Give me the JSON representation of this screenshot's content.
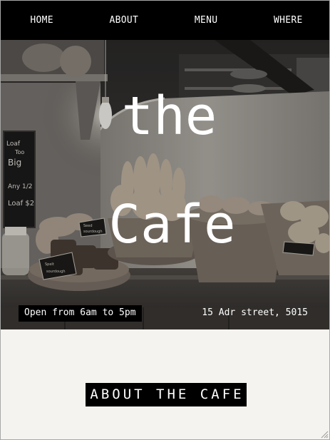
{
  "nav": {
    "items": [
      {
        "label": "HOME"
      },
      {
        "label": "ABOUT"
      },
      {
        "label": "MENU"
      },
      {
        "label": "WHERE"
      }
    ]
  },
  "hero": {
    "title_line1": "the",
    "title_line2": "Cafe",
    "hours": "Open from 6am to 5pm",
    "address": "15 Adr street, 5015",
    "chalkboard_text": "Loaf Too Big Any 1/2 Loaf $2",
    "sign_left_text": "Spelt sourdough",
    "sign_mid_text": "Seed sourdough"
  },
  "section": {
    "about_button": "ABOUT THE CAFE"
  },
  "colors": {
    "nav_bg": "#000000",
    "nav_text": "#ffffff",
    "page_bg": "#f4f3ef",
    "badge_bg": "#000000"
  },
  "icons": {
    "resize": "resize-grip-icon"
  }
}
